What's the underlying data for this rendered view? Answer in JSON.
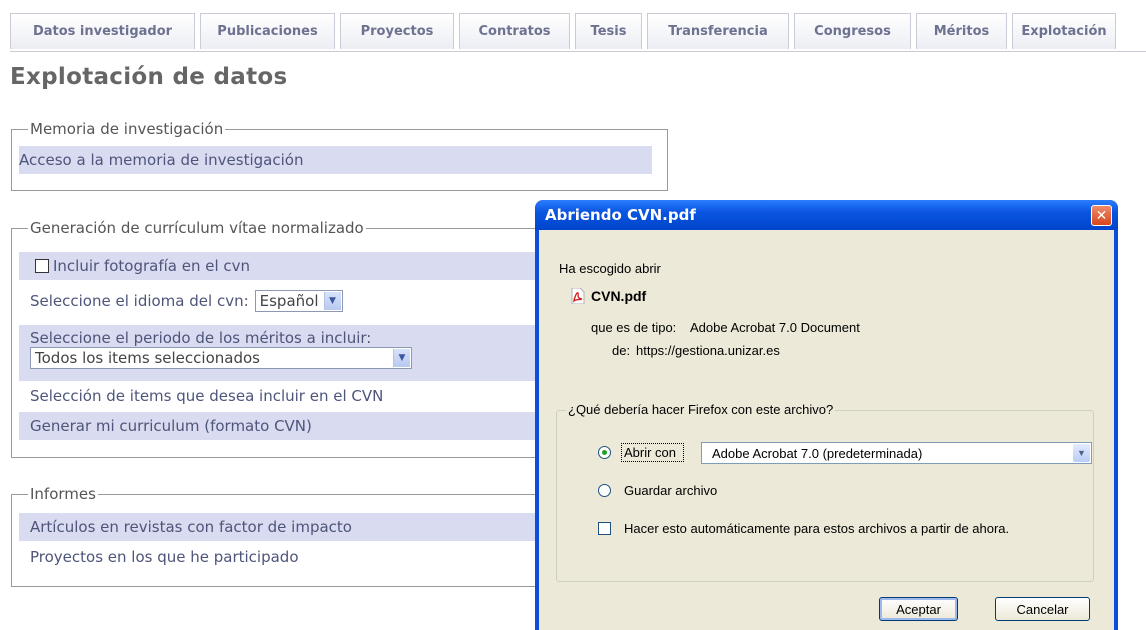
{
  "tabs": [
    "Datos investigador",
    "Publicaciones",
    "Proyectos",
    "Contratos",
    "Tesis",
    "Transferencia",
    "Congresos",
    "Méritos",
    "Explotación"
  ],
  "page_title": "Explotación de datos",
  "memoria": {
    "legend": "Memoria de investigación",
    "link": "Acceso a la memoria de investigación"
  },
  "cvn": {
    "legend": "Generación de currículum vítae normalizado",
    "include_photo": "Incluir fotografía en el cvn",
    "language_label": "Seleccione el idioma del cvn:",
    "language_value": "Español",
    "period_label": "Seleccione el periodo de los méritos a incluir:",
    "period_value": "Todos los items seleccionados",
    "select_items": "Selección de items que desea incluir en el CVN",
    "generate": "Generar mi curriculum (formato CVN)"
  },
  "informes": {
    "legend": "Informes",
    "item1": "Artículos en revistas con factor de impacto",
    "item2": "Proyectos en los que he participado"
  },
  "dialog": {
    "title": "Abriendo CVN.pdf",
    "intro": "Ha escogido abrir",
    "file_name": "CVN.pdf",
    "type_label": "que es de tipo:",
    "type_value": "Adobe Acrobat 7.0 Document",
    "from_label": "de:",
    "from_value": "https://gestiona.unizar.es",
    "question": "¿Qué debería hacer Firefox con este archivo?",
    "open_with": "Abrir con",
    "open_with_app": "Adobe Acrobat 7.0 (predeterminada)",
    "save_file": "Guardar archivo",
    "auto": "Hacer esto automáticamente para estos archivos a partir de ahora.",
    "ok": "Aceptar",
    "cancel": "Cancelar",
    "close_glyph": "✕"
  },
  "icons": {
    "select_arrow": "▼"
  }
}
